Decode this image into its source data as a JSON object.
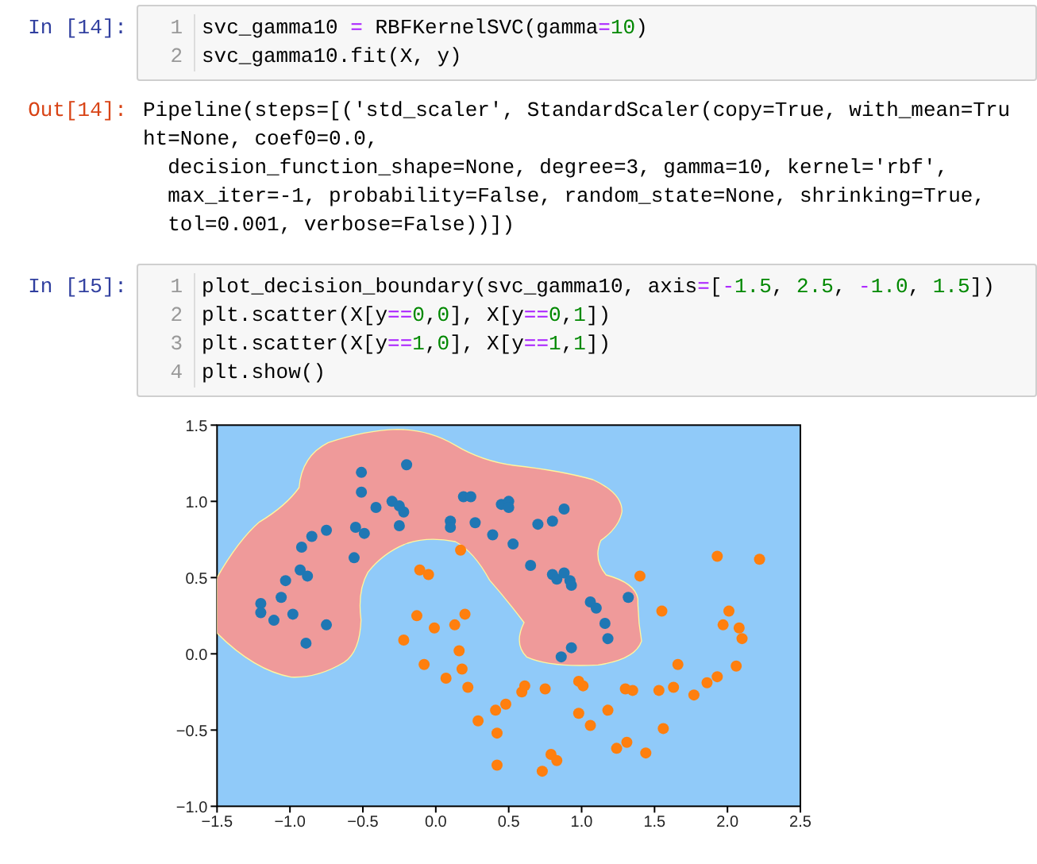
{
  "cells": [
    {
      "kind": "input",
      "prompt": "In [14]:",
      "lines": [
        {
          "number": "1",
          "code": "svc_gamma10 = RBFKernelSVC(gamma=10)"
        },
        {
          "number": "2",
          "code": "svc_gamma10.fit(X, y)"
        }
      ]
    },
    {
      "kind": "output",
      "prompt": "Out[14]:",
      "lines": [
        "Pipeline(steps=[('std_scaler', StandardScaler(copy=True, with_mean=Tru",
        "ht=None, coef0=0.0,",
        "  decision_function_shape=None, degree=3, gamma=10, kernel='rbf',",
        "  max_iter=-1, probability=False, random_state=None, shrinking=True,",
        "  tol=0.001, verbose=False))])"
      ]
    },
    {
      "kind": "input",
      "prompt": "In [15]:",
      "lines": [
        {
          "number": "1",
          "code": "plot_decision_boundary(svc_gamma10, axis=[-1.5, 2.5, -1.0, 1.5])"
        },
        {
          "number": "2",
          "code": "plt.scatter(X[y==0,0], X[y==0,1])"
        },
        {
          "number": "3",
          "code": "plt.scatter(X[y==1,0], X[y==1,1])"
        },
        {
          "number": "4",
          "code": "plt.show()"
        }
      ]
    },
    {
      "kind": "figure",
      "chart_data": {
        "type": "scatter",
        "xlim": [
          -1.5,
          2.5
        ],
        "ylim": [
          -1.0,
          1.5
        ],
        "xticks": [
          {
            "value": -1.5,
            "label": "−1.5"
          },
          {
            "value": -1.0,
            "label": "−1.0"
          },
          {
            "value": -0.5,
            "label": "−0.5"
          },
          {
            "value": 0,
            "label": "0.0"
          },
          {
            "value": 0.5,
            "label": "0.5"
          },
          {
            "value": 1.0,
            "label": "1.0"
          },
          {
            "value": 1.5,
            "label": "1.5"
          },
          {
            "value": 2.0,
            "label": "2.0"
          },
          {
            "value": 2.5,
            "label": "2.5"
          }
        ],
        "yticks": [
          {
            "value": -1.0,
            "label": "−1.0"
          },
          {
            "value": -0.5,
            "label": "−0.5"
          },
          {
            "value": 0,
            "label": "0.0"
          },
          {
            "value": 0.5,
            "label": "0.5"
          },
          {
            "value": 1.0,
            "label": "1.0"
          },
          {
            "value": 1.5,
            "label": "1.5"
          }
        ],
        "series": [
          {
            "color": "#1f77b4",
            "x": [
              -1.2,
              -1.2,
              -1.11,
              -1.06,
              -1.03,
              -0.98,
              -0.92,
              -0.93,
              -0.88,
              -0.89,
              -0.85,
              -0.75,
              -0.75,
              -0.56,
              -0.55,
              -0.49,
              -0.51,
              -0.51,
              -0.41,
              -0.3,
              -0.25,
              -0.22,
              -0.25,
              -0.2,
              0.1,
              0.1,
              0.19,
              0.24,
              0.27,
              0.39,
              0.45,
              0.5,
              0.5,
              0.53,
              0.65,
              0.7,
              0.8,
              0.88,
              0.8,
              0.83,
              0.88,
              0.92,
              0.93,
              1.06,
              1.1,
              1.16,
              1.18,
              1.32,
              0.86,
              0.93
            ],
            "values": [
              0.33,
              0.27,
              0.22,
              0.37,
              0.48,
              0.26,
              0.7,
              0.55,
              0.51,
              0.07,
              0.77,
              0.81,
              0.19,
              0.63,
              0.83,
              0.79,
              1.06,
              1.19,
              0.96,
              1.0,
              0.97,
              0.93,
              0.84,
              1.24,
              0.87,
              0.83,
              1.03,
              1.03,
              0.86,
              0.78,
              0.98,
              1.0,
              0.96,
              0.72,
              0.58,
              0.85,
              0.87,
              0.95,
              0.52,
              0.49,
              0.53,
              0.48,
              0.45,
              0.34,
              0.3,
              0.2,
              0.1,
              0.37,
              -0.02,
              0.04
            ]
          },
          {
            "color": "#ff7f0e",
            "x": [
              0.17,
              -0.11,
              -0.05,
              -0.13,
              -0.01,
              0.13,
              0.2,
              -0.22,
              -0.08,
              0.16,
              0.18,
              0.22,
              0.07,
              0.29,
              0.41,
              0.48,
              0.42,
              0.42,
              0.59,
              0.61,
              0.75,
              0.73,
              0.79,
              0.83,
              0.98,
              1.01,
              0.98,
              1.06,
              1.18,
              1.3,
              1.35,
              1.31,
              1.24,
              1.44,
              1.4,
              1.55,
              1.53,
              1.56,
              1.63,
              1.66,
              1.77,
              1.86,
              1.93,
              1.93,
              2.01,
              1.97,
              2.08,
              2.1,
              2.06,
              2.22
            ],
            "values": [
              0.68,
              0.55,
              0.52,
              0.25,
              0.17,
              0.19,
              0.26,
              0.09,
              -0.07,
              0.02,
              -0.1,
              -0.22,
              -0.16,
              -0.44,
              -0.37,
              -0.33,
              -0.52,
              -0.73,
              -0.25,
              -0.21,
              -0.23,
              -0.77,
              -0.66,
              -0.7,
              -0.18,
              -0.21,
              -0.39,
              -0.47,
              -0.37,
              -0.23,
              -0.24,
              -0.58,
              -0.62,
              -0.65,
              0.51,
              0.28,
              -0.24,
              -0.49,
              -0.22,
              -0.07,
              -0.27,
              -0.19,
              -0.15,
              0.64,
              0.28,
              0.19,
              0.17,
              0.1,
              -0.08,
              0.62
            ]
          }
        ]
      }
    }
  ]
}
